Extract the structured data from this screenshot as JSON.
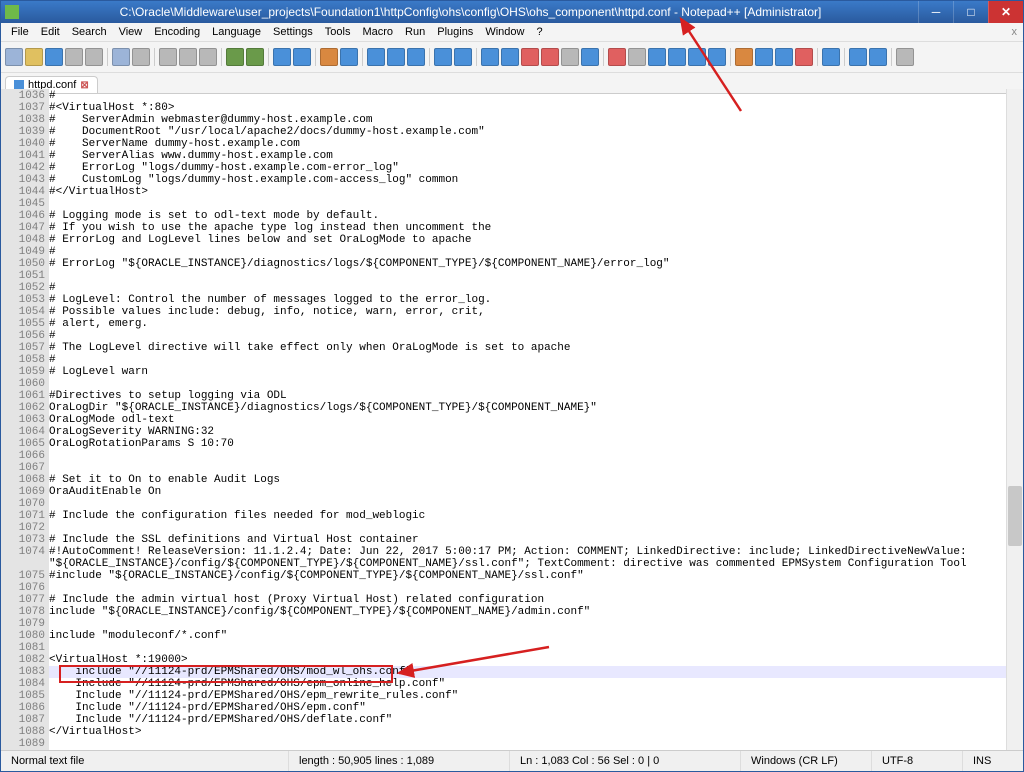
{
  "titlebar": {
    "path": "C:\\Oracle\\Middleware\\user_projects\\Foundation1\\httpConfig\\ohs\\config\\OHS\\ohs_component\\httpd.conf - Notepad++ [Administrator]"
  },
  "menu": {
    "items": [
      "File",
      "Edit",
      "Search",
      "View",
      "Encoding",
      "Language",
      "Settings",
      "Tools",
      "Macro",
      "Run",
      "Plugins",
      "Window",
      "?"
    ]
  },
  "tab": {
    "name": "httpd.conf"
  },
  "gutter_start": 1036,
  "gutter_end": 1089,
  "code_lines": [
    "#",
    "#<VirtualHost *:80>",
    "#    ServerAdmin webmaster@dummy-host.example.com",
    "#    DocumentRoot \"/usr/local/apache2/docs/dummy-host.example.com\"",
    "#    ServerName dummy-host.example.com",
    "#    ServerAlias www.dummy-host.example.com",
    "#    ErrorLog \"logs/dummy-host.example.com-error_log\"",
    "#    CustomLog \"logs/dummy-host.example.com-access_log\" common",
    "#</VirtualHost>",
    "",
    "# Logging mode is set to odl-text mode by default.",
    "# If you wish to use the apache type log instead then uncomment the",
    "# ErrorLog and LogLevel lines below and set OraLogMode to apache",
    "#",
    "# ErrorLog \"${ORACLE_INSTANCE}/diagnostics/logs/${COMPONENT_TYPE}/${COMPONENT_NAME}/error_log\"",
    "",
    "#",
    "# LogLevel: Control the number of messages logged to the error_log.",
    "# Possible values include: debug, info, notice, warn, error, crit,",
    "# alert, emerg.",
    "#",
    "# The LogLevel directive will take effect only when OraLogMode is set to apache",
    "#",
    "# LogLevel warn",
    "",
    "#Directives to setup logging via ODL",
    "OraLogDir \"${ORACLE_INSTANCE}/diagnostics/logs/${COMPONENT_TYPE}/${COMPONENT_NAME}\"",
    "OraLogMode odl-text",
    "OraLogSeverity WARNING:32",
    "OraLogRotationParams S 10:70",
    "",
    "",
    "# Set it to On to enable Audit Logs",
    "OraAuditEnable On",
    "",
    "# Include the configuration files needed for mod_weblogic",
    "",
    "# Include the SSL definitions and Virtual Host container",
    "#!AutoComment! ReleaseVersion: 11.1.2.4; Date: Jun 22, 2017 5:00:17 PM; Action: COMMENT; LinkedDirective: include; LinkedDirectiveNewValue: \"${ORACLE_INSTANCE}/config/${COMPONENT_TYPE}/${COMPONENT_NAME}/ssl.conf\"; TextComment: directive was commented EPMSystem Configuration Tool",
    "#include \"${ORACLE_INSTANCE}/config/${COMPONENT_TYPE}/${COMPONENT_NAME}/ssl.conf\"",
    "",
    "# Include the admin virtual host (Proxy Virtual Host) related configuration",
    "include \"${ORACLE_INSTANCE}/config/${COMPONENT_TYPE}/${COMPONENT_NAME}/admin.conf\"",
    "",
    "include \"moduleconf/*.conf\"",
    "",
    "<VirtualHost *:19000>",
    "    include \"//11124-prd/EPMShared/OHS/mod_wl_ohs.conf\"",
    "    Include \"//11124-prd/EPMShared/OHS/epm_online_help.conf\"",
    "    Include \"//11124-prd/EPMShared/OHS/epm_rewrite_rules.conf\"",
    "    Include \"//11124-prd/EPMShared/OHS/epm.conf\"",
    "    Include \"//11124-prd/EPMShared/OHS/deflate.conf\"",
    "</VirtualHost>",
    ""
  ],
  "highlight_line_index": 47,
  "status": {
    "filetype": "Normal text file",
    "length": "length : 50,905    lines : 1,089",
    "pos": "Ln : 1,083    Col : 56    Sel : 0 | 0",
    "eol": "Windows (CR LF)",
    "enc": "UTF-8",
    "ins": "INS"
  },
  "toolbar_icons": [
    {
      "c": "#9cb4d8"
    },
    {
      "c": "#e0c060"
    },
    {
      "c": "#4a90d9"
    },
    {
      "c": "#b8b8b8"
    },
    {
      "c": "#b8b8b8"
    },
    "sep",
    {
      "c": "#9cb4d8"
    },
    {
      "c": "#b8b8b8"
    },
    "sep",
    {
      "c": "#b8b8b8"
    },
    {
      "c": "#b8b8b8"
    },
    {
      "c": "#b8b8b8"
    },
    "sep",
    {
      "c": "#6a9a4a"
    },
    {
      "c": "#6a9a4a"
    },
    "sep",
    {
      "c": "#4a90d9"
    },
    {
      "c": "#4a90d9"
    },
    "sep",
    {
      "c": "#d98840"
    },
    {
      "c": "#4a90d9"
    },
    "sep",
    {
      "c": "#4a90d9"
    },
    {
      "c": "#4a90d9"
    },
    {
      "c": "#4a90d9"
    },
    "sep",
    {
      "c": "#4a90d9"
    },
    {
      "c": "#4a90d9"
    },
    "sep",
    {
      "c": "#4a90d9"
    },
    {
      "c": "#4a90d9"
    },
    {
      "c": "#e06060"
    },
    {
      "c": "#e06060"
    },
    {
      "c": "#b8b8b8"
    },
    {
      "c": "#4a90d9"
    },
    "sep",
    {
      "c": "#e06060"
    },
    {
      "c": "#b8b8b8"
    },
    {
      "c": "#4a90d9"
    },
    {
      "c": "#4a90d9"
    },
    {
      "c": "#4a90d9"
    },
    {
      "c": "#4a90d9"
    },
    "sep",
    {
      "c": "#d98840"
    },
    {
      "c": "#4a90d9"
    },
    {
      "c": "#4a90d9"
    },
    {
      "c": "#e06060"
    },
    "sep",
    {
      "c": "#4a90d9"
    },
    "sep",
    {
      "c": "#4a90d9"
    },
    {
      "c": "#4a90d9"
    },
    "sep",
    {
      "c": "#b8b8b8"
    }
  ]
}
